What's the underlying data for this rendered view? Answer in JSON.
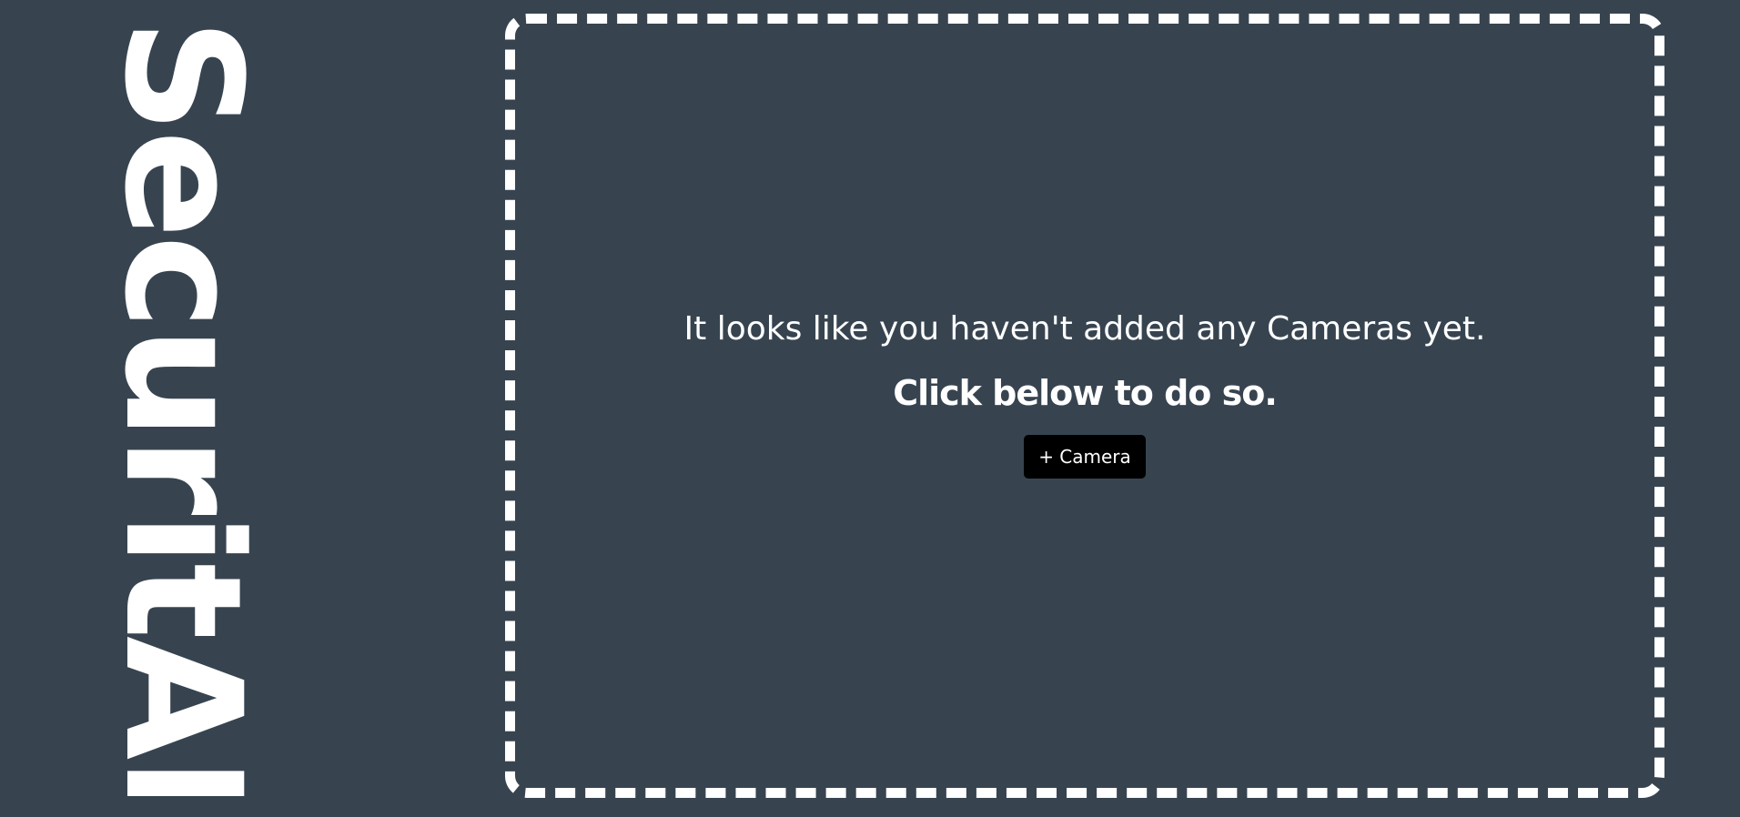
{
  "brand": {
    "name": "SecuritAI"
  },
  "empty_state": {
    "message": "It looks like you haven't added any Cameras yet.",
    "hint": "Click below to do so.",
    "add_button_label": "+ Camera"
  }
}
